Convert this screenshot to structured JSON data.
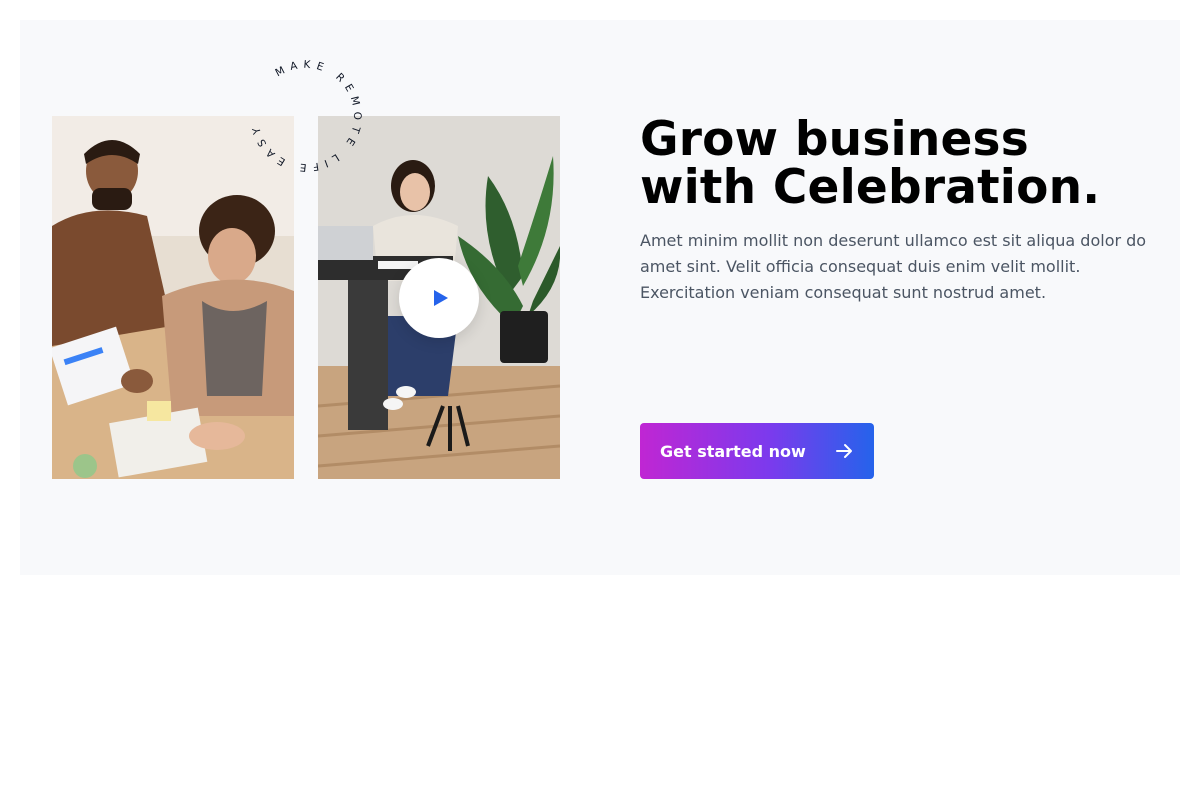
{
  "hero": {
    "headline_line1": "Grow business",
    "headline_line2": "with Celebration.",
    "description": "Amet minim mollit non deserunt ullamco est sit aliqua dolor do amet sint. Velit officia consequat duis enim velit mollit. Exercitation veniam consequat sunt nostrud amet.",
    "cta_label": "Get started now",
    "cta_icon": "arrow-right-icon",
    "badge_text": "MAKE REMOTE LIFE EASY",
    "play_icon": "play-icon"
  },
  "colors": {
    "background": "#f8f9fb",
    "headline": "#000000",
    "body_text": "#4b5563",
    "cta_gradient_start": "#c026d3",
    "cta_gradient_end": "#2563eb",
    "play_icon": "#2563eb"
  }
}
